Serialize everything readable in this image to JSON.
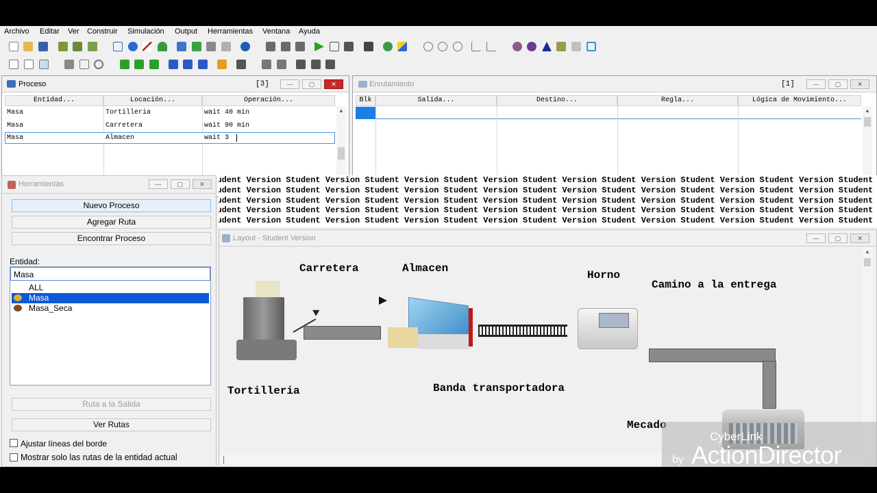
{
  "menu": [
    "Archivo",
    "Editar",
    "Ver",
    "Construir",
    "Simulación",
    "Output",
    "Herramientas",
    "Ventana",
    "Ayuda"
  ],
  "proceso": {
    "title": "Proceso",
    "counter": "[3]",
    "headers": [
      "Entidad...",
      "Locación...",
      "Operación..."
    ],
    "rows": [
      [
        "Masa",
        "Tortilleria",
        "wait 40 min"
      ],
      [
        "Masa",
        "Carretera",
        "wait 90 min"
      ],
      [
        "Masa",
        "Almacen",
        "wait 3"
      ]
    ]
  },
  "enrutamiento": {
    "title": "Enrutamiento",
    "counter": "[1]",
    "headers": [
      "Blk",
      "Salida...",
      "Destino...",
      "Regla...",
      "Lógica de Movimiento..."
    ]
  },
  "herramientas": {
    "title": "Herramientas",
    "buttons": [
      "Nuevo Proceso",
      "Agregar Ruta",
      "Encontrar Proceso"
    ],
    "entidad_label": "Entidad:",
    "entidad_value": "Masa",
    "list": [
      "ALL",
      "Masa",
      "Masa_Seca"
    ],
    "ruta_salida": "Ruta a la Salida",
    "ver_rutas": "Ver Rutas",
    "check1": "Ajustar líneas del borde",
    "check2": "Mostrar solo las rutas de la entidad actual"
  },
  "watermark": "Student Version",
  "layout": {
    "title": "Layout - Student Version",
    "labels": [
      "Carretera",
      "Almacen",
      "Horno",
      "Camino a la entrega",
      "Tortilleria",
      "Banda transportadora",
      "Mecado"
    ]
  },
  "overlay": {
    "line1": "CyberLink",
    "line2": "by",
    "line3": "ActionDirector"
  }
}
